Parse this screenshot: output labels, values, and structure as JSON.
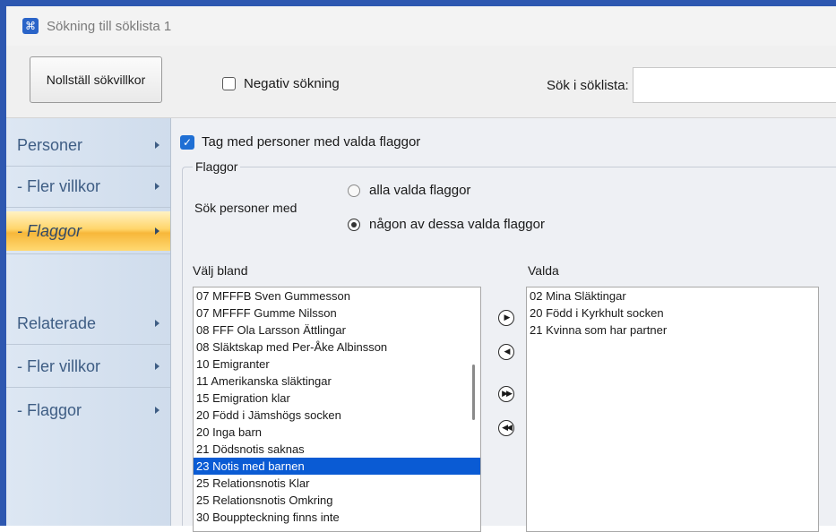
{
  "window": {
    "title": "Sökning till söklista 1",
    "icon": "app-icon"
  },
  "toolbar": {
    "reset_label": "Nollställ sökvillkor",
    "negative_search_label": "Negativ sökning",
    "negative_search_checked": false,
    "search_in_list_label": "Sök i söklista:",
    "search_in_list_value": ""
  },
  "sidebar": {
    "items": [
      {
        "label": "Personer",
        "active": false
      },
      {
        "label": "- Fler villkor",
        "active": false
      },
      {
        "label": "- Flaggor",
        "active": true
      },
      {
        "label": "Relaterade",
        "active": false
      },
      {
        "label": "- Fler villkor",
        "active": false
      },
      {
        "label": "- Flaggor",
        "active": false
      }
    ]
  },
  "main": {
    "include_flagged_label": "Tag med personer med valda flaggor",
    "include_flagged_checked": true,
    "flags_group_label": "Flaggor",
    "search_persons_label": "Sök personer med",
    "radio_all_label": "alla valda flaggor",
    "radio_any_label": "någon av dessa valda flaggor",
    "radio_selected": "any",
    "choose_from_label": "Välj bland",
    "selected_label": "Valda",
    "available_flags": [
      "07 MFFFB Sven Gummesson",
      "07 MFFFF Gumme Nilsson",
      "08 FFF Ola Larsson Ättlingar",
      "08 Släktskap med Per-Åke Albinsson",
      "10 Emigranter",
      "11 Amerikanska släktingar",
      "15 Emigration klar",
      "20 Född i Jämshögs socken",
      "20 Inga barn",
      "21 Dödsnotis saknas",
      "23 Notis med barnen",
      "25 Relationsnotis Klar",
      "25 Relationsnotis Omkring",
      "30 Bouppteckning finns inte"
    ],
    "available_selected_index": 10,
    "chosen_flags": [
      "02 Mina Släktingar",
      "20 Född i Kyrkhult socken",
      "21 Kvinna som har partner"
    ],
    "move_buttons": [
      {
        "icon": "move-right-icon",
        "glyph": "▶"
      },
      {
        "icon": "move-left-icon",
        "glyph": "◀"
      },
      {
        "icon": "move-all-right-icon",
        "glyph": "▶▶"
      },
      {
        "icon": "move-all-left-icon",
        "glyph": "◀◀"
      }
    ]
  }
}
